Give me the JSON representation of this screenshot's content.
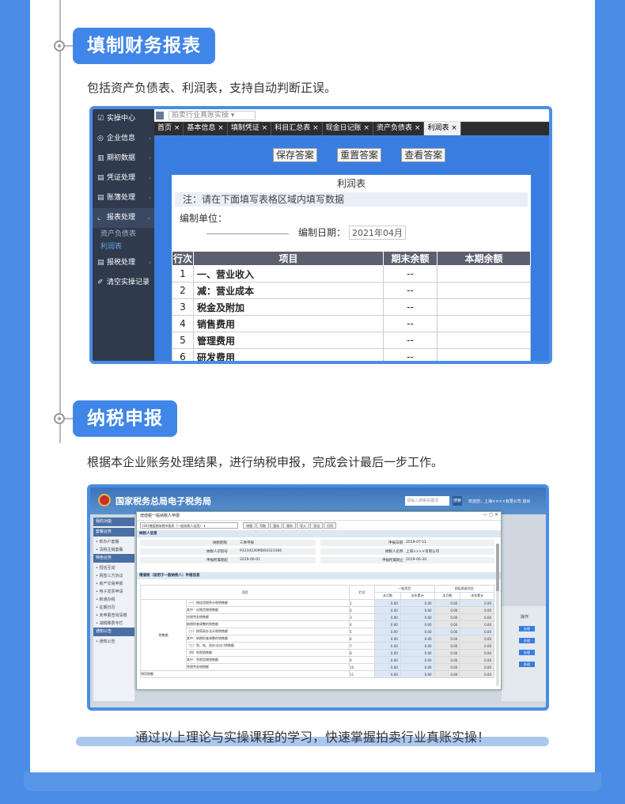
{
  "section1": {
    "pill": "填制财务报表",
    "desc": "包括资产负债表、利润表，支持自动判断正误。",
    "sidebar": [
      {
        "icon": "☑",
        "label": "实操中心",
        "caret": ""
      },
      {
        "icon": "◎",
        "label": "企业信息",
        "caret": "‹"
      },
      {
        "icon": "▥",
        "label": "期初数据",
        "caret": "‹"
      },
      {
        "icon": "▤",
        "label": "凭证处理",
        "caret": "‹"
      },
      {
        "icon": "▤",
        "label": "账簿处理",
        "caret": "‹"
      },
      {
        "icon": "⌞",
        "label": "报表处理",
        "caret": "⌄"
      }
    ],
    "subitems": [
      "资产负债表",
      "利润表"
    ],
    "sidebar_tail": [
      {
        "icon": "▤",
        "label": "报税处理",
        "caret": "‹"
      },
      {
        "icon": "✐",
        "label": "清空实操记录",
        "caret": ""
      }
    ],
    "top_select": "拍卖行业真账实操",
    "tabs": [
      "首页 ×",
      "基本信息 ×",
      "填制凭证 ×",
      "科目汇总表 ×",
      "现金日记账 ×",
      "资产负债表 ×",
      "利润表 ×"
    ],
    "buttons": {
      "save": "保存答案",
      "reset": "重置答案",
      "view": "查看答案"
    },
    "panel_title": "利润表",
    "note": "注：请在下面填写表格区域内填写数据",
    "unit_label": "编制单位：",
    "date_label": "编制日期：",
    "date_value": "2021年04月",
    "table_headers": [
      "行次",
      "项目",
      "期末余额",
      "本期余额"
    ],
    "rows": [
      {
        "n": "1",
        "name": "一、营业收入",
        "v": "--"
      },
      {
        "n": "2",
        "name": "减：营业成本",
        "v": "--"
      },
      {
        "n": "3",
        "name": "税金及附加",
        "v": "--"
      },
      {
        "n": "4",
        "name": "销售费用",
        "v": "--"
      },
      {
        "n": "5",
        "name": "管理费用",
        "v": "--"
      },
      {
        "n": "6",
        "name": "研发费用",
        "v": "--"
      }
    ]
  },
  "section2": {
    "pill": "纳税申报",
    "desc": "根据本企业账务处理结果，进行纳税申报，完成会计最后一步工作。",
    "site_title": "国家税务总局电子税务局",
    "search_placeholder": "请输入搜索关键词",
    "search_btn": "搜索",
    "user": "欢迎您，上海××××有限公司  退出",
    "side": [
      {
        "h": "我的功能"
      },
      {
        "h": "套餐业务"
      },
      {
        "l": "• 新办户套餐"
      },
      {
        "l": "• 清税注销套餐"
      },
      {
        "h": "特色业务"
      },
      {
        "l": "• 短信互动"
      },
      {
        "l": "• 网签三方协议"
      },
      {
        "l": "• 房产交易申报"
      },
      {
        "l": "• 电子发票申请"
      },
      {
        "l": "• 新通办税"
      },
      {
        "l": "• 征期日历"
      },
      {
        "l": "• 未申报查询清缴"
      },
      {
        "l": "• 减税降费专栏"
      },
      {
        "h": "通知公告"
      },
      {
        "l": "• 通知公告"
      }
    ],
    "modal_title": "增值税一般纳税人申报",
    "dropdown": "(04)增值税纳税申报表（一般纳税人适用）",
    "tool_buttons": [
      "申报",
      "写取",
      "暂存",
      "保存",
      "导入",
      "导出",
      "打印"
    ],
    "sec1": "纳税人信息",
    "info": {
      "taxtype_label": "纳税期限",
      "taxtype": "三季申报",
      "code_label": "纳税人识别号",
      "code": "91234230MD64323166",
      "start_label": "申报所属期起",
      "start": "2019-06-01",
      "date_label": "申报日期",
      "date": "2019-07-11",
      "name_label": "纳税人名称",
      "name": "上海××××有限公司",
      "end_label": "申报所属期止",
      "end": "2019-06-30"
    },
    "sec2": "增值税（适用于一般纳税人）申报信息",
    "grid_head": [
      "项目",
      "栏次",
      "一般项目",
      "即征即退项目"
    ],
    "grid_sub": [
      "本月数",
      "本年累计",
      "本月数",
      "本年累计"
    ],
    "group_label": "销售额",
    "grid_rows": [
      {
        "name": "（一）按适用税率计税销售额",
        "col": "1"
      },
      {
        "name": "其中：应税货物销售额",
        "col": "2"
      },
      {
        "name": "应税劳务销售额",
        "col": "3"
      },
      {
        "name": "纳税检查调整的销售额",
        "col": "4"
      },
      {
        "name": "（二）按简易办法计税销售额",
        "col": "5"
      },
      {
        "name": "其中：纳税检查调整的销售额",
        "col": "6"
      },
      {
        "name": "（三）免、抵、退办法出口销售额",
        "col": "7"
      },
      {
        "name": "（四）免税销售额",
        "col": "8"
      },
      {
        "name": "其中：免税货物销售额",
        "col": "9"
      },
      {
        "name": "免税劳务销售额",
        "col": "10"
      },
      {
        "name": "销项税额",
        "col": "11"
      }
    ],
    "grid_value": "0.00",
    "op_label": "操作",
    "op_btn": "办理"
  },
  "footer": "通过以上理论与实操课程的学习，快速掌握拍卖行业真账实操！"
}
